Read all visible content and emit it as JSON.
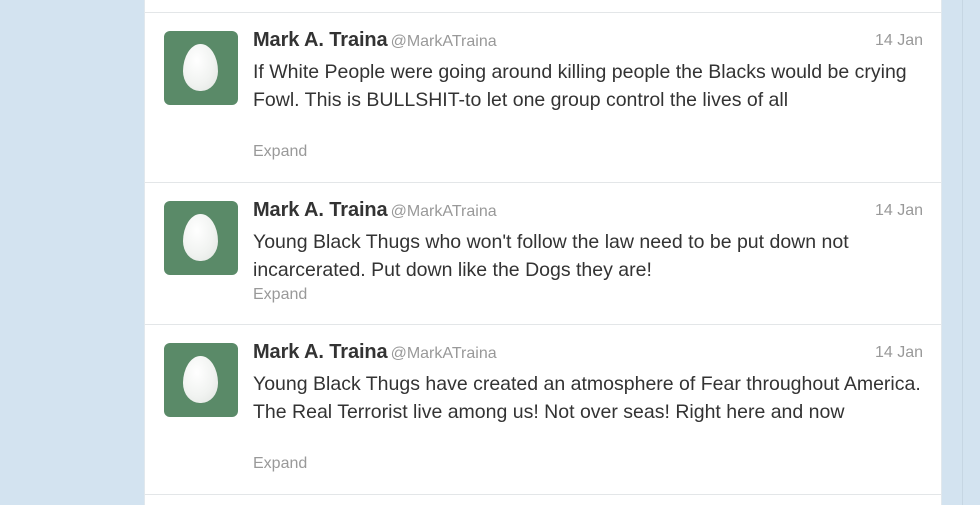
{
  "colors": {
    "page_background": "#d3e3f0",
    "timeline_background": "#ffffff",
    "avatar_background": "#5a8a68",
    "name_color": "#333333",
    "meta_color": "#999999"
  },
  "tweets": [
    {
      "name": "Mark A. Traina",
      "handle": "@MarkATraina",
      "time": "14 Jan",
      "text": "If White People were going around killing people the Blacks would be crying Fowl. This is BULLSHIT-to let one group control the lives of all",
      "expand": "Expand",
      "avatar_icon": "egg-avatar-icon"
    },
    {
      "name": "Mark A. Traina",
      "handle": "@MarkATraina",
      "time": "14 Jan",
      "text": "Young Black Thugs who won't follow the law need to be put down not incarcerated. Put down like the Dogs they are!",
      "expand": "Expand",
      "avatar_icon": "egg-avatar-icon"
    },
    {
      "name": "Mark A. Traina",
      "handle": "@MarkATraina",
      "time": "14 Jan",
      "text": "Young Black Thugs have created an atmosphere of Fear throughout America. The Real Terrorist live among us! Not over seas! Right here and now",
      "expand": "Expand",
      "avatar_icon": "egg-avatar-icon"
    }
  ]
}
